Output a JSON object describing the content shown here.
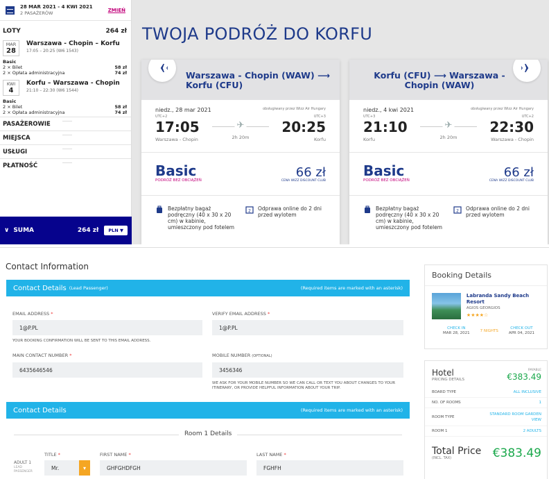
{
  "top": {
    "date_range": "28 MAR 2021 - 4 KWI 2021",
    "passengers": "2 PASAŻERÓW",
    "change_label": "ZMIEŃ",
    "flights_label": "LOTY",
    "flights_total": "264 zł",
    "flights": [
      {
        "month": "MAR",
        "day": "28",
        "route": "Warszawa - Chopin – Korfu",
        "time": "17:05 – 20:25 (W6 1543)",
        "fare": "Basic",
        "lines": [
          {
            "label": "2 × Bilet",
            "value": "58 zł"
          },
          {
            "label": "2 × Opłata administracyjna",
            "value": "74 zł"
          }
        ]
      },
      {
        "month": "KWI",
        "day": "4",
        "route": "Korfu – Warszawa - Chopin",
        "time": "21:10 – 22:30 (W6 1544)",
        "fare": "Basic",
        "lines": [
          {
            "label": "2 × Bilet",
            "value": "58 zł"
          },
          {
            "label": "2 × Opłata administracyjna",
            "value": "74 zł"
          }
        ]
      }
    ],
    "sections": [
      "PASAŻEROWIE",
      "MIEJSCA",
      "USŁUGI",
      "PŁATNOŚĆ"
    ],
    "sum_label": "SUMA",
    "sum_amount": "264 zł",
    "currency": "PLN",
    "trip_title": "TWOJA PODRÓŻ DO KORFU",
    "cards": [
      {
        "title": "Warszawa - Chopin (WAW) ⟶ Korfu (CFU)",
        "date": "niedz., 28 mar 2021",
        "operator": "obsługiwany przez Wizz Air Hungary",
        "utc_dep": "UTC+2",
        "utc_arr": "UTC+3",
        "dep_time": "17:05",
        "arr_time": "20:25",
        "duration": "2h 20m",
        "dep_place": "Warszawa - Chopin",
        "arr_place": "Korfu",
        "fare": "Basic",
        "fare_sub": "PODRÓŻ BEZ OBCIĄŻEŃ",
        "price": "66 zł",
        "price_sub": "CENA WIZZ DISCOUNT CLUB",
        "perk1": "Bezpłatny bagaż podręczny (40 x 30 x 20 cm) w kabinie, umieszczony pod fotelem",
        "perk2": "Odprawa online do 2 dni przed wylotem"
      },
      {
        "title": "Korfu (CFU) ⟶ Warszawa - Chopin (WAW)",
        "date": "niedz., 4 kwi 2021",
        "operator": "obsługiwany przez Wizz Air Hungary",
        "utc_dep": "UTC+3",
        "utc_arr": "UTC+2",
        "dep_time": "21:10",
        "arr_time": "22:30",
        "duration": "2h 20m",
        "dep_place": "Korfu",
        "arr_place": "Warszawa - Chopin",
        "fare": "Basic",
        "fare_sub": "PODRÓŻ BEZ OBCIĄŻEŃ",
        "price": "66 zł",
        "price_sub": "CENA WIZZ DISCOUNT CLUB",
        "perk1": "Bezpłatny bagaż podręczny (40 x 30 x 20 cm) w kabinie, umieszczony pod fotelem",
        "perk2": "Odprawa online do 2 dni przed wylotem"
      }
    ]
  },
  "bottom": {
    "contact_info_title": "Contact Information",
    "lead_bar": {
      "title": "Contact Details",
      "sub": "(Lead Passenger)",
      "req": "(Required items are marked with an asterisk)"
    },
    "email_label": "EMAIL ADDRESS",
    "email_value": "1@P.PL",
    "verify_label": "VERIFY EMAIL ADDRESS",
    "verify_value": "1@P.PL",
    "email_note": "YOUR BOOKING CONFIRMATION WILL BE SENT TO THIS EMAIL ADDRESS.",
    "main_label": "MAIN CONTACT NUMBER",
    "main_value": "6435646546",
    "mobile_label": "MOBILE NUMBER",
    "mobile_opt": "(OPTIONAL)",
    "mobile_value": "3456346",
    "mobile_note": "WE ASK FOR YOUR MOBILE NUMBER SO WE CAN CALL OR TEXT YOU ABOUT CHANGES TO YOUR ITINERARY, OR PROVIDE HELPFUL INFORMATION ABOUT YOUR TRIP.",
    "second_bar": {
      "title": "Contact Details",
      "req": "(Required items are marked with an asterisk)"
    },
    "room_label": "Room 1 Details",
    "title_label": "TITLE",
    "title_value": "Mr.",
    "first_label": "FIRST NAME",
    "first_value": "GHFGHDFGH",
    "last_label": "LAST NAME",
    "last_value": "FGHFH",
    "adult_label": "ADULT 1",
    "lead_small": "LEAD PASSENGER",
    "asterisk": "*"
  },
  "booking": {
    "title": "Booking Details",
    "hotel_name": "Labranda Sandy Beach Resort",
    "hotel_loc": "AGIOS GEORGIOS",
    "stars": "★★★★☆",
    "checkin_label": "CHECK IN",
    "checkin_date": "MAR 28, 2021",
    "nights": "7 NIGHTS",
    "checkout_label": "CHECK OUT",
    "checkout_date": "APR 04, 2021"
  },
  "pricing": {
    "hotel_label": "Hotel",
    "pricing_details": "PRICING DETAILS",
    "payable": "PAYABLE",
    "amount": "€383.49",
    "rows": [
      {
        "k": "BOARD TYPE",
        "v": "ALL INCLUSIVE"
      },
      {
        "k": "NO. OF ROOMS",
        "v": "1"
      },
      {
        "k": "ROOM TYPE",
        "v": "STANDARD ROOM GARDEN VIEW"
      },
      {
        "k": "ROOM 1",
        "v": "2 ADULTS"
      }
    ],
    "total_label": "Total Price",
    "incl_tax": "(INCL. TAX)",
    "total_amount": "€383.49"
  }
}
